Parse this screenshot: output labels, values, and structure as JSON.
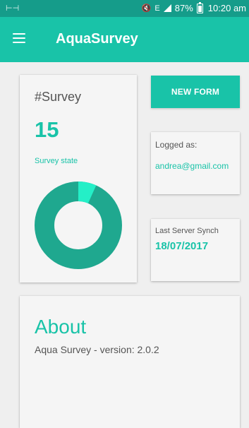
{
  "status_bar": {
    "battery_percent": "87%",
    "time": "10:20 am"
  },
  "app_bar": {
    "title": "AquaSurvey",
    "menu_icon": "hamburger-menu-icon"
  },
  "survey_card": {
    "title": "#Survey",
    "count": "15",
    "state_label": "Survey state",
    "state_fraction": 0.067
  },
  "actions": {
    "new_form_label": "NEW FORM"
  },
  "login": {
    "label": "Logged as:",
    "email": "andrea@gmail.com"
  },
  "sync": {
    "label": "Last Server Synch",
    "date": "18/07/2017"
  },
  "about": {
    "title": "About",
    "version_text": "Aqua Survey - version: 2.0.2"
  },
  "colors": {
    "primary": "#19c3a8",
    "primary_dark": "#159c8a",
    "donut_main": "#1fa88f",
    "donut_highlight": "#24efc7"
  }
}
